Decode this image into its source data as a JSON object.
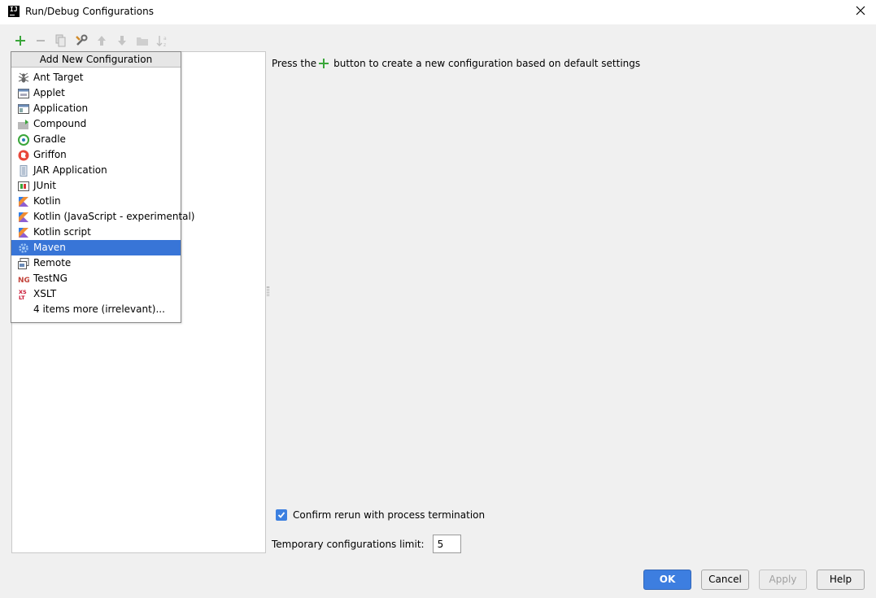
{
  "window": {
    "title": "Run/Debug Configurations",
    "app_icon_text": "IJ"
  },
  "toolbar": {
    "buttons": [
      "add-icon",
      "remove-icon",
      "copy-icon",
      "edit-defaults-icon",
      "move-up-icon",
      "move-down-icon",
      "folder-icon",
      "sort-icon"
    ]
  },
  "popup": {
    "header": "Add New Configuration",
    "items": [
      {
        "label": "Ant Target",
        "icon": "ant-icon"
      },
      {
        "label": "Applet",
        "icon": "applet-icon"
      },
      {
        "label": "Application",
        "icon": "application-icon"
      },
      {
        "label": "Compound",
        "icon": "compound-icon"
      },
      {
        "label": "Gradle",
        "icon": "gradle-icon"
      },
      {
        "label": "Griffon",
        "icon": "griffon-icon"
      },
      {
        "label": "JAR Application",
        "icon": "jar-icon"
      },
      {
        "label": "JUnit",
        "icon": "junit-icon"
      },
      {
        "label": "Kotlin",
        "icon": "kotlin-icon"
      },
      {
        "label": "Kotlin (JavaScript - experimental)",
        "icon": "kotlin-icon"
      },
      {
        "label": "Kotlin script",
        "icon": "kotlin-icon"
      },
      {
        "label": "Maven",
        "icon": "maven-icon"
      },
      {
        "label": "Remote",
        "icon": "remote-icon"
      },
      {
        "label": "TestNG",
        "icon": "testng-icon"
      },
      {
        "label": "XSLT",
        "icon": "xslt-icon"
      },
      {
        "label": "4 items more (irrelevant)...",
        "icon": ""
      }
    ],
    "selected": "Maven"
  },
  "info": {
    "before": "Press the",
    "after": "button to create a new configuration based on default settings"
  },
  "settings": {
    "confirm_rerun_label": "Confirm rerun with process termination",
    "confirm_rerun_checked": true,
    "temp_limit_label": "Temporary configurations limit:",
    "temp_limit_value": "5"
  },
  "buttons": {
    "ok": "OK",
    "cancel": "Cancel",
    "apply": "Apply",
    "help": "Help"
  },
  "colors": {
    "accent": "#3875d7",
    "plus_green": "#3aa63a",
    "ok_button": "#3d7ee0"
  }
}
